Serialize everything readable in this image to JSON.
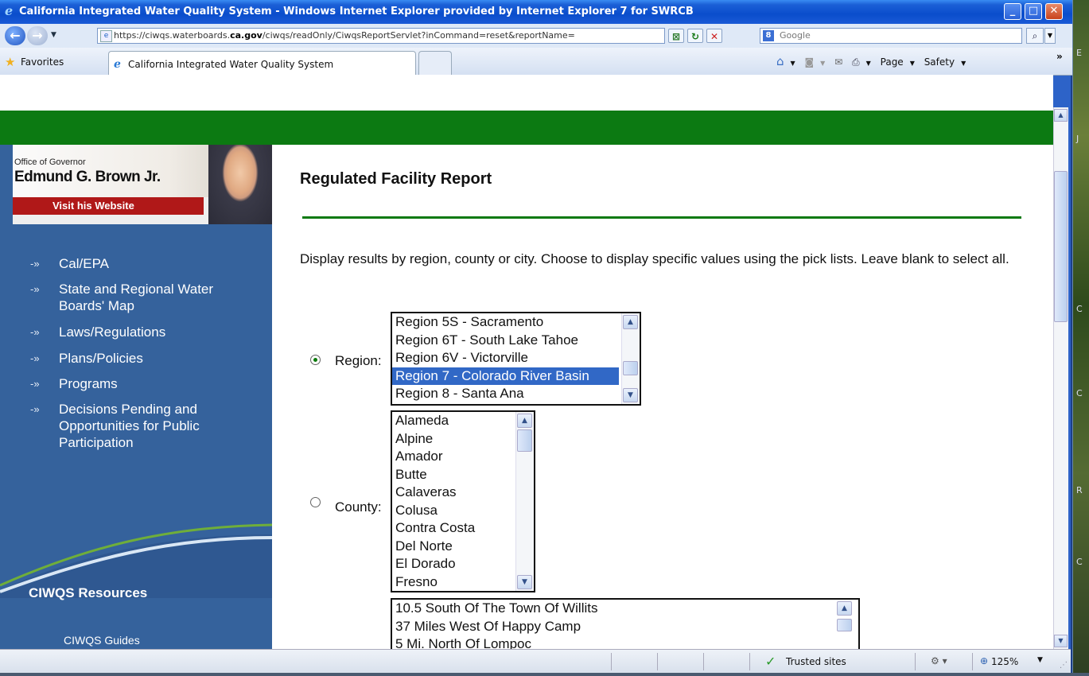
{
  "window": {
    "title": "California Integrated Water Quality System - Windows Internet Explorer provided by Internet Explorer 7 for SWRCB",
    "minimize": "_",
    "maximize": "□",
    "close": "✕"
  },
  "address_bar": {
    "url_prefix": "https://ciwqs.waterboards.",
    "url_domain": "ca.gov",
    "url_suffix": "/ciwqs/readOnly/CiwqsReportServlet?inCommand=reset&reportName=",
    "search_placeholder": "Google"
  },
  "favorites_bar": {
    "favorites_label": "Favorites",
    "tab_label": "California Integrated Water Quality System",
    "page_menu": "Page",
    "safety_menu": "Safety"
  },
  "banner": {
    "office": "Office of Governor",
    "name": "Edmund G. Brown Jr.",
    "visit": "Visit his Website"
  },
  "sidebar": {
    "items": [
      {
        "label": "Cal/EPA"
      },
      {
        "label": "State and Regional Water Boards' Map"
      },
      {
        "label": "Laws/Regulations"
      },
      {
        "label": "Plans/Policies"
      },
      {
        "label": "Programs"
      },
      {
        "label": "Decisions Pending and Opportunities for Public Participation"
      }
    ],
    "resources_heading": "CIWQS Resources",
    "resources_first_item": "CIWQS Guides"
  },
  "main": {
    "title": "Regulated Facility Report",
    "description": "Display results by region, county or city. Choose to display specific values using the pick lists. Leave blank to select all.",
    "region_label": "Region:",
    "county_label": "County:",
    "region_selected": true,
    "region_options": [
      "Region 5S - Sacramento",
      "Region 6T - South Lake Tahoe",
      "Region 6V - Victorville",
      "Region 7 - Colorado River Basin",
      "Region 8 - Santa Ana"
    ],
    "region_selected_option": "Region 7 - Colorado River Basin",
    "county_options": [
      "Alameda",
      "Alpine",
      "Amador",
      "Butte",
      "Calaveras",
      "Colusa",
      "Contra Costa",
      "Del Norte",
      "El Dorado",
      "Fresno"
    ],
    "city_options": [
      "10.5 South Of The Town Of Willits",
      "37 Miles West Of Happy Camp",
      "5 Mi. North Of Lompoc"
    ]
  },
  "statusbar": {
    "trusted": "Trusted sites",
    "zoom": "125%"
  },
  "colors": {
    "green_bar": "#0c7a12",
    "sidebar_blue": "#35629c",
    "selection_blue": "#3168c6"
  }
}
